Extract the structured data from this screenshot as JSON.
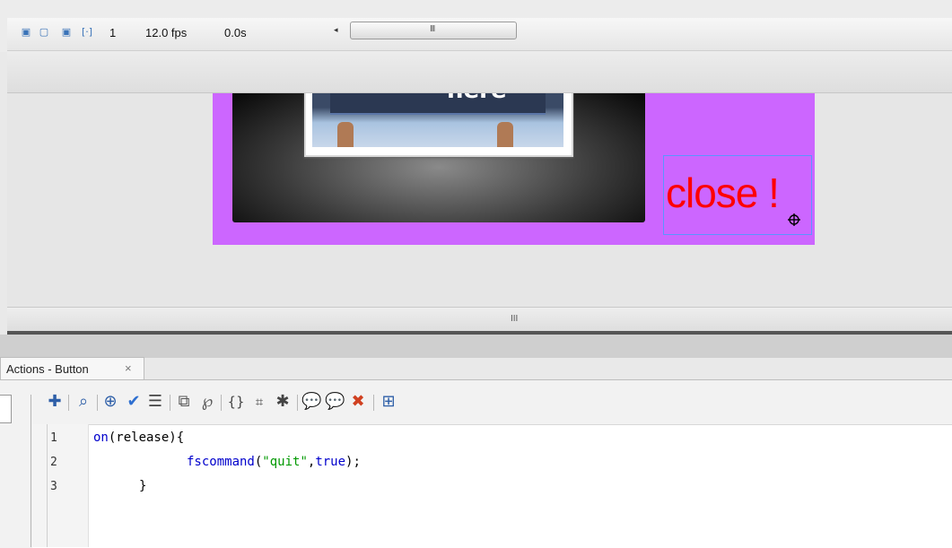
{
  "timeline": {
    "icons": [
      "onion-skin-icon",
      "onion-outline-icon",
      "edit-multiple-frames-icon",
      "modify-onion-markers-icon"
    ],
    "current_frame": "1",
    "frame_rate": "12.0 fps",
    "elapsed_time": "0.0s",
    "scroll_left": "◂",
    "scroll_grip": "III"
  },
  "stage": {
    "background_color": "#cc66ff",
    "photo_caption": "here",
    "close_button_text": "close !",
    "close_text_color": "#ff0000"
  },
  "splitter": {
    "grip": "III"
  },
  "actions_panel": {
    "tab_label": "Actions - Button",
    "tab_close": "×",
    "toolbar_icons": [
      "add-script-item-icon",
      "find-icon",
      "insert-target-path-icon",
      "check-syntax-icon",
      "auto-format-icon",
      "show-code-hint-icon",
      "debug-options-icon",
      "collapse-between-braces-icon",
      "collapse-selection-icon",
      "expand-all-icon",
      "apply-block-comment-icon",
      "apply-line-comment-icon",
      "remove-comment-icon",
      "show-hide-toolbox-icon"
    ],
    "line_numbers": [
      "1",
      "2",
      "3"
    ],
    "code": {
      "line1_kw": "on",
      "line1_rest": "(release){",
      "line2_kw": "fscommand",
      "line2_open": "(",
      "line2_str": "\"quit\"",
      "line2_comma": ",",
      "line2_bool": "true",
      "line2_close": ");",
      "line3": "}"
    }
  }
}
